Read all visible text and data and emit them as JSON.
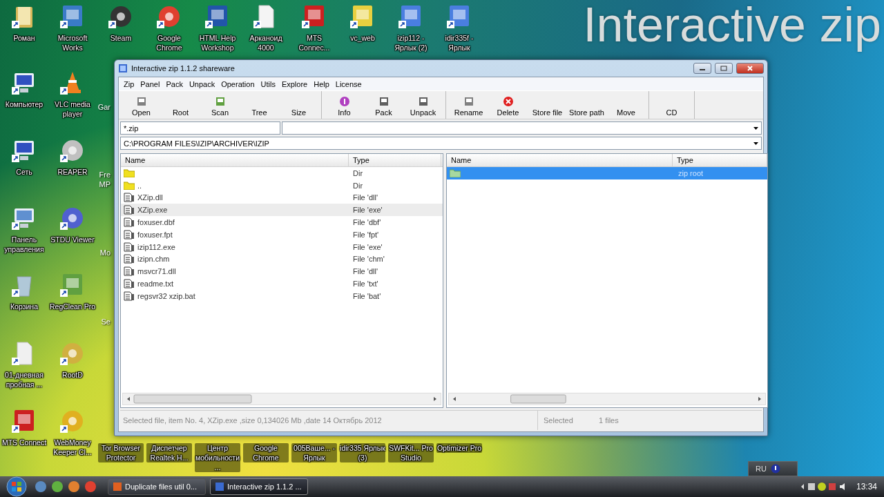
{
  "background_title": "Interactive zip",
  "desktop": {
    "top_row": [
      {
        "label": "Роман"
      },
      {
        "label": "Microsoft Works"
      },
      {
        "label": "Steam"
      },
      {
        "label": "Google Chrome"
      },
      {
        "label": "HTML Help Workshop"
      },
      {
        "label": "Арканоид 4000"
      },
      {
        "label": "MTS Connec..."
      },
      {
        "label": "vc_web"
      },
      {
        "label": "izip112 - Ярлык (2)"
      },
      {
        "label": "idir335f - Ярлык"
      }
    ],
    "column_1": [
      {
        "label": "Компьютер"
      },
      {
        "label": "Сеть"
      },
      {
        "label": "Панель управления"
      },
      {
        "label": "Корзина"
      },
      {
        "label": "01-дневная пробная ..."
      },
      {
        "label": "MTS Connect"
      }
    ],
    "column_2": [
      {
        "label": "VLC media player"
      },
      {
        "label": "REAPER"
      },
      {
        "label": "STDU Viewer"
      },
      {
        "label": "RegClean Pro"
      },
      {
        "label": "RootD"
      },
      {
        "label": "WebMoney Keeper Cl..."
      }
    ],
    "column_3": [
      {
        "label": "Gar"
      },
      {
        "label": "Fre MP"
      },
      {
        "label": "Mo"
      },
      {
        "label": "Se"
      }
    ],
    "bottom_labels": [
      {
        "label": "Tor Browser Protector"
      },
      {
        "label": "Диспетчер Realtek H..."
      },
      {
        "label": "Центр мобильности..."
      },
      {
        "label": "Google Chrome"
      },
      {
        "label": "005Ваше... - Ярлык"
      },
      {
        "label": "idir335 Ярлык (3)"
      },
      {
        "label": "SWFKit... Pro Studio"
      },
      {
        "label": "Optimizer Pro"
      }
    ]
  },
  "window": {
    "title": "Interactive zip 1.1.2 shareware",
    "menu": [
      "Zip",
      "Panel",
      "Pack",
      "Unpack",
      "Operation",
      "Utils",
      "Explore",
      "Help",
      "License"
    ],
    "toolbar": [
      [
        {
          "label": "Open",
          "kind": "icon"
        },
        {
          "label": "Root",
          "kind": "plain"
        },
        {
          "label": "Scan",
          "kind": "icon"
        },
        {
          "label": "Tree",
          "kind": "plain"
        },
        {
          "label": "Size",
          "kind": "plain"
        }
      ],
      [
        {
          "label": "Info",
          "kind": "icon"
        },
        {
          "label": "Pack",
          "kind": "icon"
        },
        {
          "label": "Unpack",
          "kind": "icon"
        }
      ],
      [
        {
          "label": "Rename",
          "kind": "icon"
        },
        {
          "label": "Delete",
          "kind": "icon"
        },
        {
          "label": "Store file",
          "kind": "plain"
        },
        {
          "label": "Store path",
          "kind": "plain"
        },
        {
          "label": "Move",
          "kind": "plain"
        }
      ],
      [
        {
          "label": "CD",
          "kind": "plain"
        }
      ]
    ],
    "filter": "*.zip",
    "path": "C:\\PROGRAM FILES\\IZIP\\ARCHIVER\\IZIP",
    "left_panel": {
      "focused": false,
      "columns": [
        "Name",
        "Type"
      ],
      "rows": [
        {
          "kind": "folder",
          "type": "Dir",
          "selected": false
        },
        {
          "kind": "folder",
          "name": "..",
          "type": "Dir",
          "selected": false
        },
        {
          "kind": "file",
          "name": "XZip.dll",
          "type": "File 'dll'",
          "selected": false
        },
        {
          "kind": "file",
          "name": "XZip.exe",
          "type": "File 'exe'",
          "selected": true
        },
        {
          "kind": "file",
          "name": "foxuser.dbf",
          "type": "File 'dbf'",
          "selected": false
        },
        {
          "kind": "file",
          "name": "foxuser.fpt",
          "type": "File 'fpt'",
          "selected": false
        },
        {
          "kind": "file",
          "name": "izip112.exe",
          "type": "File 'exe'",
          "selected": false
        },
        {
          "kind": "file",
          "name": "izipn.chm",
          "type": "File 'chm'",
          "selected": false
        },
        {
          "kind": "file",
          "name": "msvcr71.dll",
          "type": "File 'dll'",
          "selected": false
        },
        {
          "kind": "file",
          "name": "readme.txt",
          "type": "File 'txt'",
          "selected": false
        },
        {
          "kind": "file",
          "name": "regsvr32 xzip.bat",
          "type": "File 'bat'",
          "selected": false
        }
      ]
    },
    "right_panel": {
      "focused": true,
      "columns": [
        "Name",
        "Type"
      ],
      "rows": [
        {
          "kind": "archive",
          "type": "zip root",
          "selected": true
        }
      ]
    },
    "status": {
      "message": "Selected file, item No. 4, XZip.exe ,size 0,134026 Mb ,date 14 Октябрь 2012",
      "label": "Selected",
      "count": "1 files"
    }
  },
  "taskbar": {
    "tasks": [
      {
        "label": "Duplicate files util 0...",
        "selected": false
      },
      {
        "label": "Interactive zip 1.1.2 ...",
        "selected": true
      }
    ],
    "language": "RU",
    "clock": "13:34"
  }
}
